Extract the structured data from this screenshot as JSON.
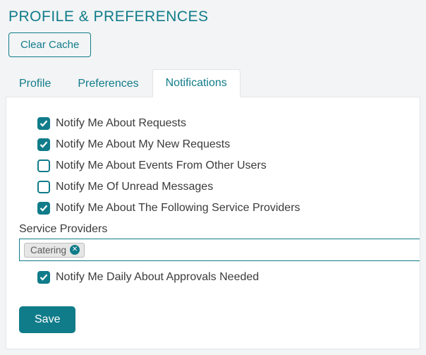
{
  "header": {
    "title": "PROFILE & PREFERENCES",
    "clear_cache_label": "Clear Cache"
  },
  "tabs": {
    "items": [
      {
        "label": "Profile",
        "active": false
      },
      {
        "label": "Preferences",
        "active": false
      },
      {
        "label": "Notifications",
        "active": true
      }
    ]
  },
  "notifications": {
    "checks": [
      {
        "label": "Notify Me About Requests",
        "checked": true
      },
      {
        "label": "Notify Me About My New Requests",
        "checked": true
      },
      {
        "label": "Notify Me About Events From Other Users",
        "checked": false
      },
      {
        "label": "Notify Me Of Unread Messages",
        "checked": false
      },
      {
        "label": "Notify Me About The Following Service Providers",
        "checked": true
      }
    ],
    "service_providers_label": "Service Providers",
    "tags": [
      {
        "label": "Catering"
      }
    ],
    "approvals": {
      "label": "Notify Me Daily About Approvals Needed",
      "checked": true
    },
    "save_label": "Save"
  },
  "colors": {
    "accent": "#107c8a"
  }
}
